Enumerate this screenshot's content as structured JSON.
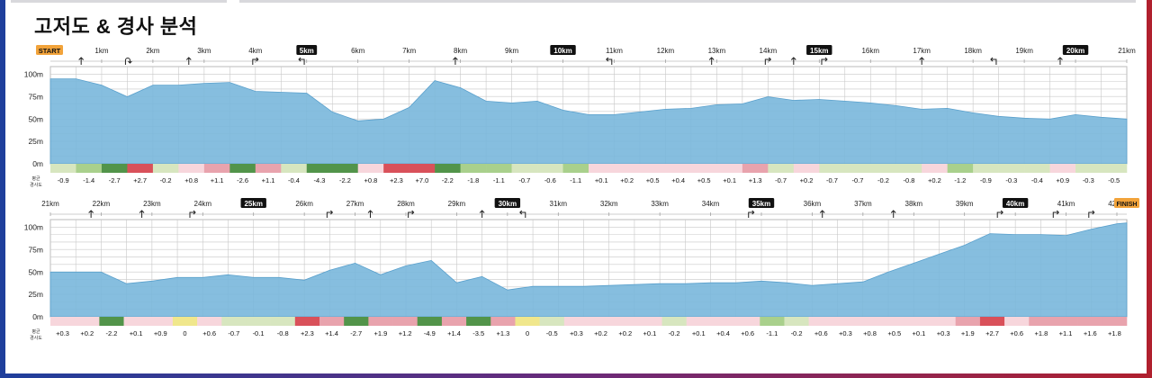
{
  "page": {
    "title": "고저도 & 경사 분석"
  },
  "chart_data": [
    {
      "type": "area",
      "title": "고저도 & 경사 분석",
      "xlabel": "",
      "ylabel": "",
      "x_range_km": [
        0,
        21
      ],
      "ylim": [
        0,
        100
      ],
      "y_ticks": [
        "100m",
        "75m",
        "50m",
        "25m",
        "0m"
      ],
      "start_label": "START",
      "km_labels": [
        "1km",
        "2km",
        "3km",
        "4km",
        "5km",
        "6km",
        "7km",
        "8km",
        "9km",
        "10km",
        "11km",
        "12km",
        "13km",
        "14km",
        "15km",
        "16km",
        "17km",
        "18km",
        "19km",
        "20km",
        "21km"
      ],
      "highlight_km": [
        "5km",
        "10km",
        "15km",
        "20km"
      ],
      "elevation_km": [
        0,
        0.5,
        1,
        1.5,
        2,
        2.5,
        3,
        3.5,
        4,
        4.5,
        5,
        5.5,
        6,
        6.5,
        7,
        7.5,
        8,
        8.5,
        9,
        9.5,
        10,
        10.5,
        11,
        11.5,
        12,
        12.5,
        13,
        13.5,
        14,
        14.5,
        15,
        15.5,
        16,
        16.5,
        17,
        17.5,
        18,
        18.5,
        19,
        19.5,
        20,
        20.5,
        21
      ],
      "elevation_m": [
        95,
        95,
        88,
        75,
        88,
        88,
        90,
        91,
        81,
        80,
        79,
        58,
        48,
        50,
        63,
        93,
        85,
        70,
        68,
        70,
        60,
        55,
        55,
        58,
        61,
        62,
        66,
        67,
        75,
        71,
        72,
        70,
        68,
        65,
        61,
        62,
        57,
        53,
        51,
        50,
        55,
        52,
        50
      ],
      "grade_label": "평균 경사도",
      "grade_values": [
        "-0.9",
        "-1.4",
        "-2.7",
        "+2.7",
        "-0.2",
        "+0.8",
        "+1.1",
        "-2.6",
        "+1.1",
        "-0.4",
        "-4.3",
        "-2.2",
        "+0.8",
        "+2.3",
        "+7.0",
        "-2.2",
        "-1.8",
        "-1.1",
        "-0.7",
        "-0.6",
        "-1.1",
        "+0.1",
        "+0.2",
        "+0.5",
        "+0.4",
        "+0.5",
        "+0.1",
        "+1.3",
        "-0.7",
        "+0.2",
        "-0.7",
        "-0.7",
        "-0.2",
        "-0.8",
        "+0.2",
        "-1.2",
        "-0.9",
        "-0.3",
        "-0.4",
        "+0.9",
        "-0.3",
        "-0.5"
      ],
      "turns": [
        {
          "km": 0.6,
          "dir": "up"
        },
        {
          "km": 1.5,
          "dir": "uturn"
        },
        {
          "km": 2.7,
          "dir": "up"
        },
        {
          "km": 4.0,
          "dir": "right"
        },
        {
          "km": 4.9,
          "dir": "left"
        },
        {
          "km": 7.9,
          "dir": "up"
        },
        {
          "km": 10.9,
          "dir": "left"
        },
        {
          "km": 12.9,
          "dir": "up"
        },
        {
          "km": 14.0,
          "dir": "right"
        },
        {
          "km": 14.5,
          "dir": "up"
        },
        {
          "km": 15.1,
          "dir": "right"
        },
        {
          "km": 17.0,
          "dir": "up"
        },
        {
          "km": 18.4,
          "dir": "left"
        },
        {
          "km": 19.7,
          "dir": "up"
        }
      ]
    },
    {
      "type": "area",
      "xlabel": "",
      "ylabel": "",
      "x_range_km": [
        21,
        42.195
      ],
      "ylim": [
        0,
        100
      ],
      "y_ticks": [
        "100m",
        "75m",
        "50m",
        "25m",
        "0m"
      ],
      "finish_label": "FINISH",
      "km_labels": [
        "21km",
        "22km",
        "23km",
        "24km",
        "25km",
        "26km",
        "27km",
        "28km",
        "29km",
        "30km",
        "31km",
        "32km",
        "33km",
        "34km",
        "35km",
        "36km",
        "37km",
        "38km",
        "39km",
        "40km",
        "41km",
        "42km"
      ],
      "highlight_km": [
        "25km",
        "30km",
        "35km",
        "40km"
      ],
      "elevation_km": [
        21,
        21.5,
        22,
        22.5,
        23,
        23.5,
        24,
        24.5,
        25,
        25.5,
        26,
        26.5,
        27,
        27.5,
        28,
        28.5,
        29,
        29.5,
        30,
        30.5,
        31,
        31.5,
        32,
        32.5,
        33,
        33.5,
        34,
        34.5,
        35,
        35.5,
        36,
        36.5,
        37,
        37.5,
        38,
        38.5,
        39,
        39.5,
        40,
        40.5,
        41,
        41.5,
        42,
        42.195
      ],
      "elevation_m": [
        50,
        50,
        50,
        37,
        40,
        44,
        44,
        47,
        44,
        44,
        41,
        52,
        60,
        47,
        57,
        63,
        38,
        45,
        30,
        34,
        34,
        34,
        35,
        36,
        37,
        37,
        38,
        38,
        40,
        38,
        35,
        37,
        39,
        50,
        60,
        70,
        80,
        93,
        92,
        92,
        91,
        98,
        104,
        105
      ],
      "grade_label": "평균 경사도",
      "grade_values": [
        "+0.3",
        "+0.2",
        "-2.2",
        "+0.1",
        "+0.9",
        "0",
        "+0.6",
        "-0.7",
        "-0.1",
        "-0.8",
        "+2.3",
        "+1.4",
        "-2.7",
        "+1.9",
        "+1.2",
        "-4.9",
        "+1.4",
        "-3.5",
        "+1.3",
        "0",
        "-0.5",
        "+0.3",
        "+0.2",
        "+0.2",
        "+0.1",
        "-0.2",
        "+0.1",
        "+0.4",
        "+0.6",
        "-1.1",
        "-0.2",
        "+0.6",
        "+0.3",
        "+0.8",
        "+0.5",
        "+0.1",
        "+0.3",
        "+1.9",
        "+2.7",
        "+0.6",
        "+1.8",
        "+1.1",
        "+1.6",
        "+1.8"
      ],
      "turns": [
        {
          "km": 21.8,
          "dir": "up"
        },
        {
          "km": 22.8,
          "dir": "up"
        },
        {
          "km": 23.8,
          "dir": "right"
        },
        {
          "km": 26.5,
          "dir": "right"
        },
        {
          "km": 27.3,
          "dir": "up"
        },
        {
          "km": 28.1,
          "dir": "right"
        },
        {
          "km": 29.5,
          "dir": "up"
        },
        {
          "km": 30.3,
          "dir": "left"
        },
        {
          "km": 34.8,
          "dir": "right"
        },
        {
          "km": 36.2,
          "dir": "up"
        },
        {
          "km": 37.6,
          "dir": "up"
        },
        {
          "km": 39.7,
          "dir": "right"
        },
        {
          "km": 40.8,
          "dir": "right"
        },
        {
          "km": 41.5,
          "dir": "right"
        }
      ]
    }
  ]
}
